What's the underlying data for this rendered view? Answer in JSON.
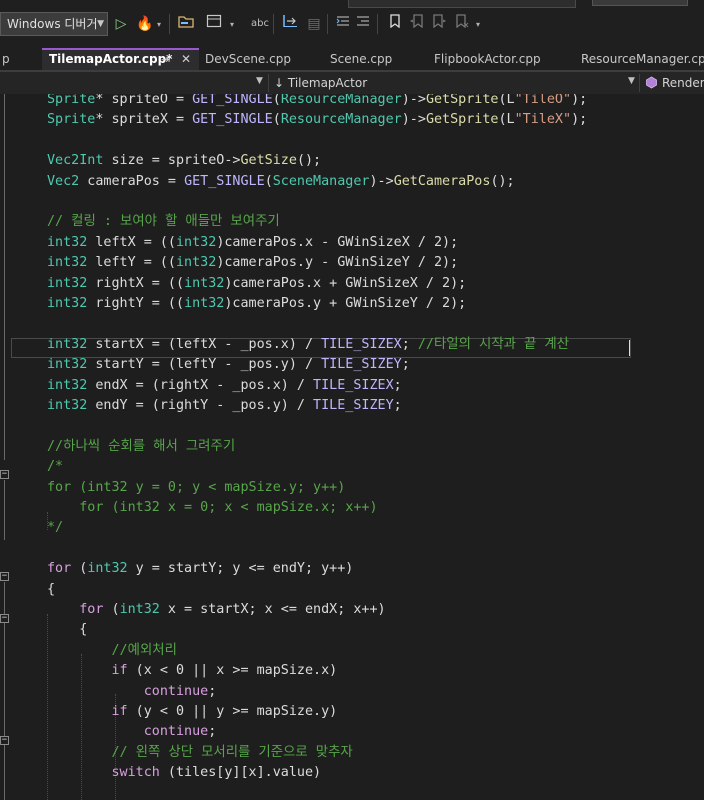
{
  "toolbar": {
    "debugger_label": "Windows 디버거",
    "icons": [
      "start-icon",
      "hot-reload-icon",
      "open-folder-icon",
      "layout-icon",
      "spell-check-icon",
      "step-icon",
      "format-icon",
      "outdent-icon",
      "bookmark-icon",
      "bookmark-prev-icon",
      "bookmark-next-icon",
      "bookmark-clear-icon"
    ]
  },
  "tabs": [
    {
      "label": "TilemapActor.cpp*",
      "active": true
    },
    {
      "label": "DevScene.cpp",
      "active": false
    },
    {
      "label": "Scene.cpp",
      "active": false
    },
    {
      "label": "FlipbookActor.cpp",
      "active": false
    },
    {
      "label": "ResourceManager.cpp",
      "active": false
    }
  ],
  "tab_controls": {
    "pin": "⇥",
    "close": "✕"
  },
  "navbar": {
    "scope": "TilemapActor",
    "member": "Render("
  },
  "code_lines": [
    [
      [
        "ty",
        "Sprite"
      ],
      [
        "plain",
        "* spriteO = "
      ],
      [
        "mac",
        "GET_SINGLE"
      ],
      [
        "plain",
        "("
      ],
      [
        "ty",
        "ResourceManager"
      ],
      [
        "plain",
        ")->"
      ],
      [
        "fn",
        "GetSprite"
      ],
      [
        "plain",
        "(L"
      ],
      [
        "str",
        "\"TileO\""
      ],
      [
        "plain",
        ");"
      ]
    ],
    [
      [
        "ty",
        "Sprite"
      ],
      [
        "plain",
        "* spriteX = "
      ],
      [
        "mac",
        "GET_SINGLE"
      ],
      [
        "plain",
        "("
      ],
      [
        "ty",
        "ResourceManager"
      ],
      [
        "plain",
        ")->"
      ],
      [
        "fn",
        "GetSprite"
      ],
      [
        "plain",
        "(L"
      ],
      [
        "str",
        "\"TileX\""
      ],
      [
        "plain",
        ");"
      ]
    ],
    [],
    [
      [
        "ty",
        "Vec2Int"
      ],
      [
        "plain",
        " size = spriteO->"
      ],
      [
        "fn",
        "GetSize"
      ],
      [
        "plain",
        "();"
      ]
    ],
    [
      [
        "ty",
        "Vec2"
      ],
      [
        "plain",
        " cameraPos = "
      ],
      [
        "mac",
        "GET_SINGLE"
      ],
      [
        "plain",
        "("
      ],
      [
        "ty",
        "SceneManager"
      ],
      [
        "plain",
        ")->"
      ],
      [
        "fn",
        "GetCameraPos"
      ],
      [
        "plain",
        "();"
      ]
    ],
    [],
    [
      [
        "cm",
        "// 컬링 : 보여야 할 애들만 보여주기"
      ]
    ],
    [
      [
        "ty",
        "int32"
      ],
      [
        "plain",
        " leftX = (("
      ],
      [
        "ty",
        "int32"
      ],
      [
        "plain",
        ")cameraPos.x - GWinSizeX / 2);"
      ]
    ],
    [
      [
        "ty",
        "int32"
      ],
      [
        "plain",
        " leftY = (("
      ],
      [
        "ty",
        "int32"
      ],
      [
        "plain",
        ")cameraPos.y - GWinSizeY / 2);"
      ]
    ],
    [
      [
        "ty",
        "int32"
      ],
      [
        "plain",
        " rightX = (("
      ],
      [
        "ty",
        "int32"
      ],
      [
        "plain",
        ")cameraPos.x + GWinSizeX / 2);"
      ]
    ],
    [
      [
        "ty",
        "int32"
      ],
      [
        "plain",
        " rightY = (("
      ],
      [
        "ty",
        "int32"
      ],
      [
        "plain",
        ")cameraPos.y + GWinSizeY / 2);"
      ]
    ],
    [],
    [
      [
        "ty",
        "int32"
      ],
      [
        "plain",
        " startX = (leftX - _pos.x) / "
      ],
      [
        "mac",
        "TILE_SIZEX"
      ],
      [
        "plain",
        ";"
      ],
      [
        "cm",
        " //타일의 시작과 끝 계산"
      ]
    ],
    [
      [
        "ty",
        "int32"
      ],
      [
        "plain",
        " startY = (leftY - _pos.y) / "
      ],
      [
        "mac",
        "TILE_SIZEY"
      ],
      [
        "plain",
        ";"
      ]
    ],
    [
      [
        "ty",
        "int32"
      ],
      [
        "plain",
        " endX = (rightX - _pos.x) / "
      ],
      [
        "mac",
        "TILE_SIZEX"
      ],
      [
        "plain",
        ";"
      ]
    ],
    [
      [
        "ty",
        "int32"
      ],
      [
        "plain",
        " endY = (rightY - _pos.y) / "
      ],
      [
        "mac",
        "TILE_SIZEY"
      ],
      [
        "plain",
        ";"
      ]
    ],
    [],
    [
      [
        "cm",
        "//하나씩 순회를 해서 그려주기"
      ]
    ],
    [
      [
        "cm",
        "/*"
      ]
    ],
    [
      [
        "cm",
        "for (int32 y = 0; y < mapSize.y; y++)"
      ]
    ],
    [
      [
        "cm",
        "    for (int32 x = 0; x < mapSize.x; x++)"
      ]
    ],
    [
      [
        "cm",
        "*/"
      ]
    ],
    [],
    [
      [
        "ctl",
        "for"
      ],
      [
        "plain",
        " ("
      ],
      [
        "ty",
        "int32"
      ],
      [
        "plain",
        " y = startY; y <= endY; y++)"
      ]
    ],
    [
      [
        "plain",
        "{"
      ]
    ],
    [
      [
        "plain",
        "    "
      ],
      [
        "ctl",
        "for"
      ],
      [
        "plain",
        " ("
      ],
      [
        "ty",
        "int32"
      ],
      [
        "plain",
        " x = startX; x <= endX; x++)"
      ]
    ],
    [
      [
        "plain",
        "    {"
      ]
    ],
    [
      [
        "plain",
        "        "
      ],
      [
        "cm",
        "//예외처리"
      ]
    ],
    [
      [
        "plain",
        "        "
      ],
      [
        "ctl",
        "if"
      ],
      [
        "plain",
        " (x < 0 || x >= mapSize.x)"
      ]
    ],
    [
      [
        "plain",
        "            "
      ],
      [
        "ctl",
        "continue"
      ],
      [
        "plain",
        ";"
      ]
    ],
    [
      [
        "plain",
        "        "
      ],
      [
        "ctl",
        "if"
      ],
      [
        "plain",
        " (y < 0 || y >= mapSize.y)"
      ]
    ],
    [
      [
        "plain",
        "            "
      ],
      [
        "ctl",
        "continue"
      ],
      [
        "plain",
        ";"
      ]
    ],
    [
      [
        "plain",
        "        "
      ],
      [
        "cm",
        "// 왼쪽 상단 모서리를 기준으로 맞추자"
      ]
    ],
    [
      [
        "plain",
        "        "
      ],
      [
        "ctl",
        "switch"
      ],
      [
        "plain",
        " (tiles[y][x].value)"
      ]
    ]
  ]
}
